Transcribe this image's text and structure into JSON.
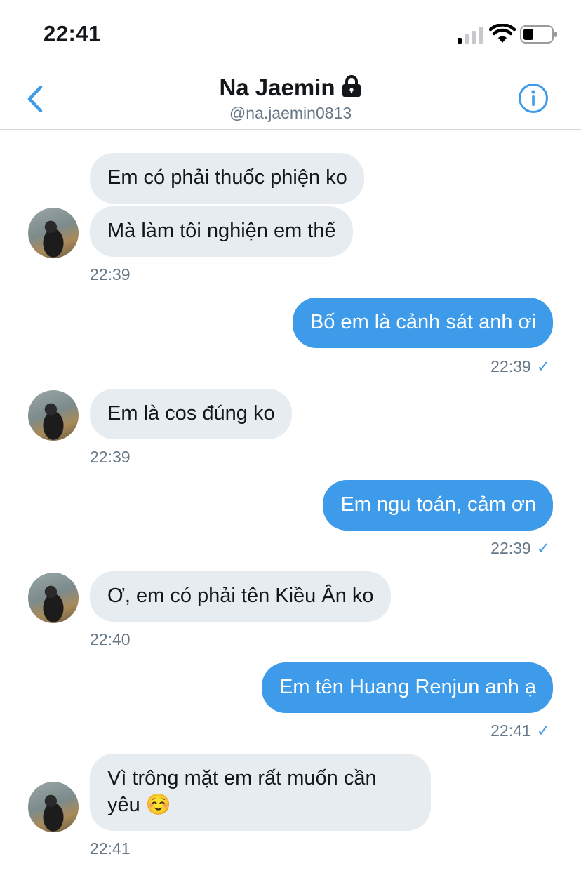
{
  "status_bar": {
    "time": "22:41"
  },
  "header": {
    "title": "Na Jaemin",
    "handle": "@na.jaemin0813"
  },
  "messages": [
    {
      "dir": "received",
      "text": "Em có phải thuốc phiện ko"
    },
    {
      "dir": "received",
      "text": "Mà làm tôi nghiện em thế",
      "time": "22:39"
    },
    {
      "dir": "sent",
      "text": "Bố em là cảnh sát anh ơi",
      "time": "22:39",
      "read_mark": "✓"
    },
    {
      "dir": "received",
      "text": "Em là cos đúng ko",
      "time": "22:39"
    },
    {
      "dir": "sent",
      "text": "Em ngu toán, cảm ơn",
      "time": "22:39",
      "read_mark": "✓"
    },
    {
      "dir": "received",
      "text": "Ơ, em có phải tên Kiều Ân ko",
      "time": "22:40"
    },
    {
      "dir": "sent",
      "text": "Em tên Huang Renjun anh ạ",
      "time": "22:41",
      "read_mark": "✓"
    },
    {
      "dir": "received",
      "text": "Vì trông mặt em rất muốn cần\nyêu ☺️",
      "time": "22:41"
    }
  ],
  "colors": {
    "accent": "#3d9be9",
    "received_bubble": "#e6ecf0",
    "muted": "#657786"
  },
  "icons": [
    "back-chevron-icon",
    "lock-icon",
    "info-icon",
    "signal-icon",
    "wifi-icon",
    "battery-icon"
  ]
}
